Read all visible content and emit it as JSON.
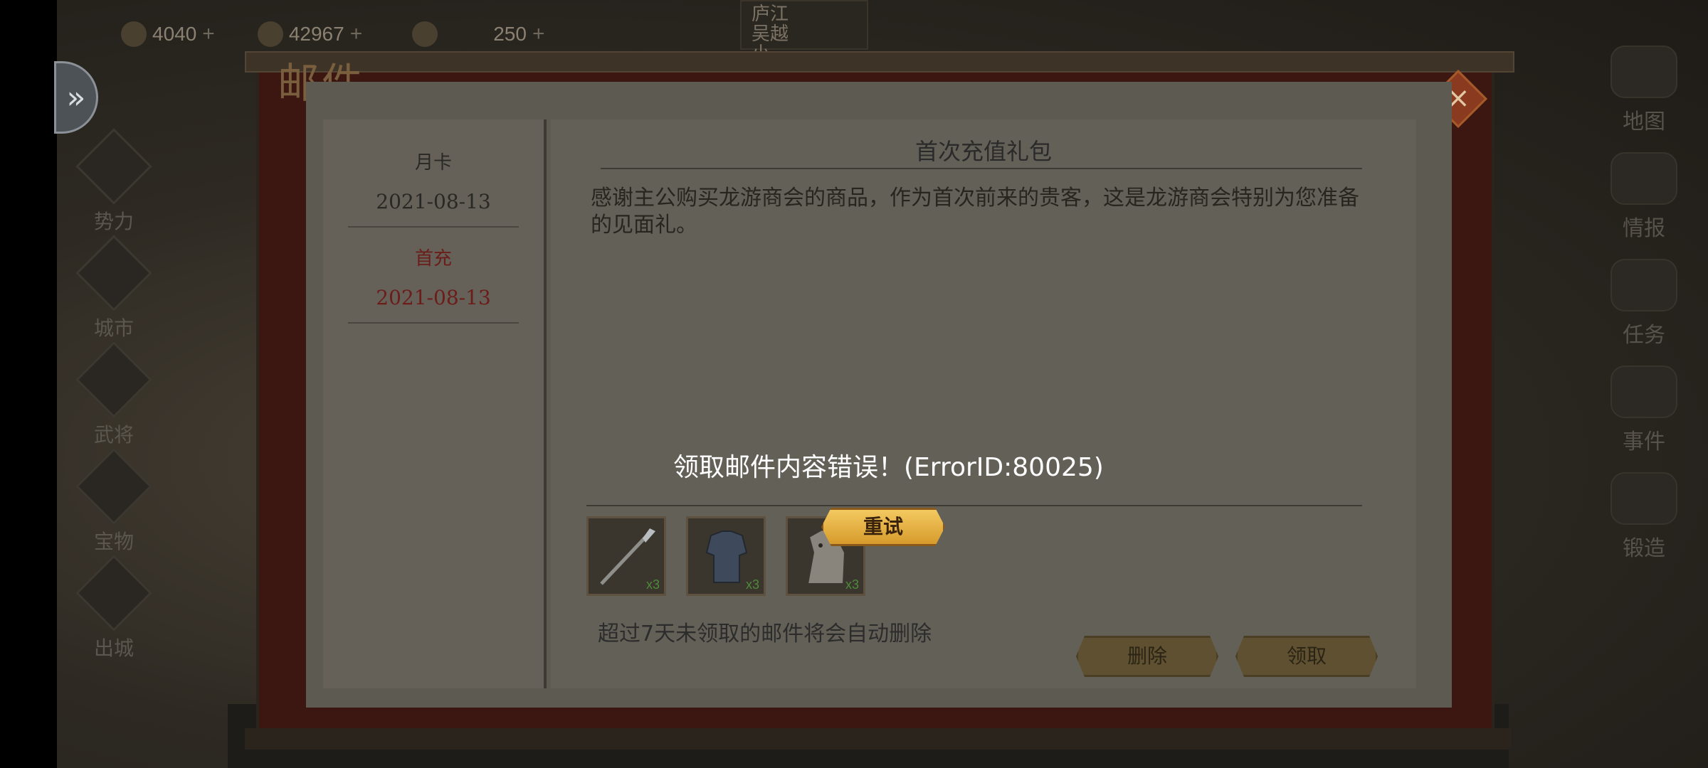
{
  "topbar": {
    "resource1": "4040",
    "resource2": "42967",
    "resource3": "250",
    "location": "庐江\n吴越\n小"
  },
  "left_menu": [
    "势力",
    "城市",
    "武将",
    "宝物",
    "出城"
  ],
  "right_menu": [
    "地图",
    "情报",
    "任务",
    "事件",
    "锻造"
  ],
  "mail": {
    "title": "邮件",
    "close_icon": "×",
    "list": [
      {
        "title": "月卡",
        "date": "2021-08-13"
      },
      {
        "title": "首充",
        "date": "2021-08-13"
      }
    ],
    "subject": "首次充值礼包",
    "body": "感谢主公购买龙游商会的商品，作为首次前来的贵客，这是龙游商会特别为您准备的见面礼。",
    "attachments": [
      {
        "name": "spear-item-icon",
        "count": "x3"
      },
      {
        "name": "armor-item-icon",
        "count": "x3"
      },
      {
        "name": "horse-item-icon",
        "count": "x3"
      }
    ],
    "notice": "超过7天未领取的邮件将会自动删除",
    "delete_label": "删除",
    "claim_label": "领取"
  },
  "error": {
    "message": "领取邮件内容错误！(ErrorID:80025)",
    "retry_label": "重试"
  },
  "colors": {
    "error_text": "#ffffff",
    "retry_bg": "#e8b64a",
    "selected_mail": "#6b1d1a"
  }
}
